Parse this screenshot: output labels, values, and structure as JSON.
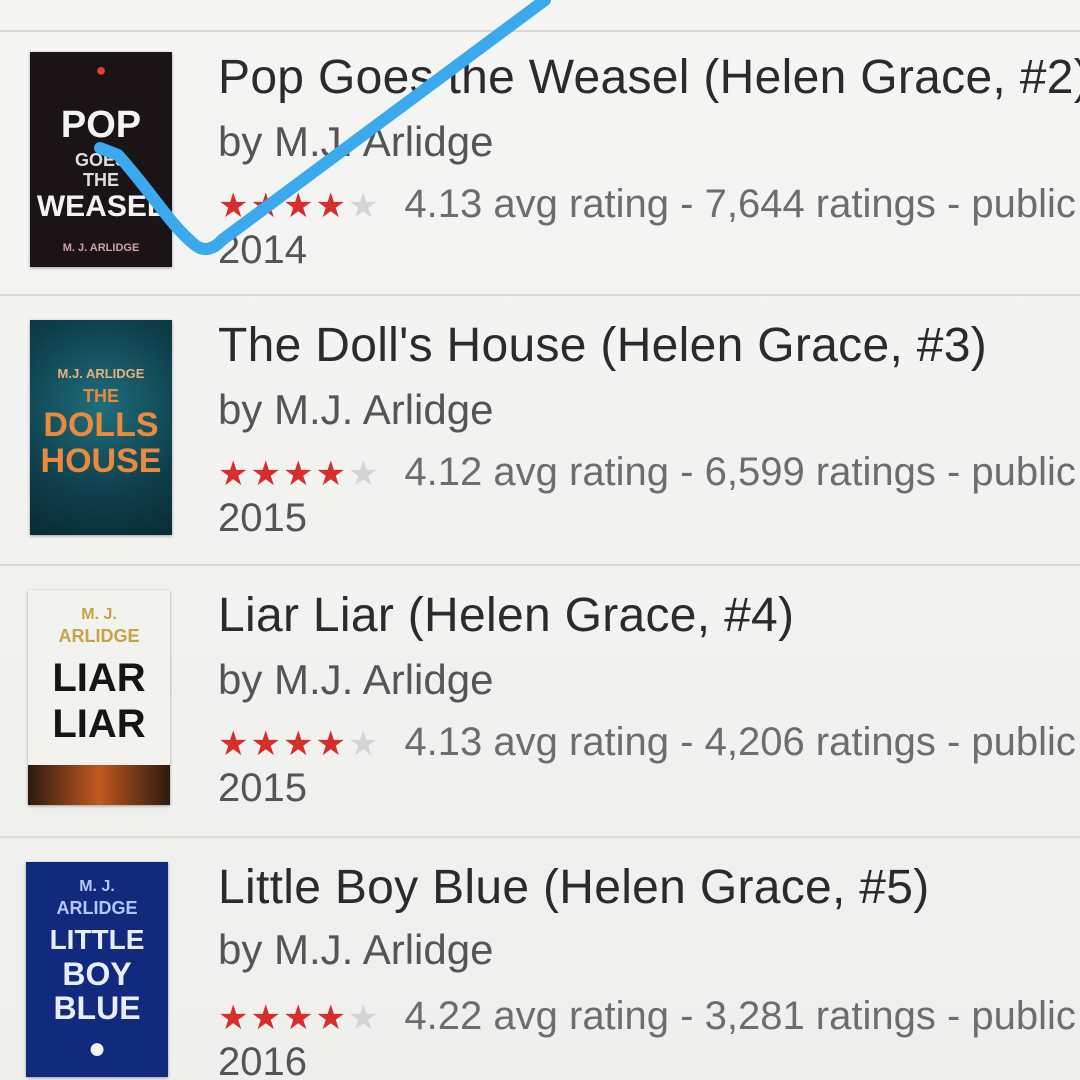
{
  "books": [
    {
      "title": "Pop Goes the Weasel (Helen Grace, #2)",
      "author": "by M.J. Arlidge",
      "rating_stars": 4,
      "meta": "4.13 avg rating - 7,644 ratings - public",
      "year": "2014",
      "cover_lines": [
        "POP",
        "GOES",
        "THE",
        "WEASEL",
        "M. J. ARLIDGE"
      ]
    },
    {
      "title": "The Doll's House (Helen Grace, #3)",
      "author": "by M.J. Arlidge",
      "rating_stars": 4,
      "meta": "4.12 avg rating - 6,599 ratings - public",
      "year": "2015",
      "cover_lines": [
        "M.J. ARLIDGE",
        "THE",
        "DOLLS",
        "HOUSE"
      ]
    },
    {
      "title": "Liar Liar (Helen Grace, #4)",
      "author": "by M.J. Arlidge",
      "rating_stars": 4,
      "meta": "4.13 avg rating - 4,206 ratings - public",
      "year": "2015",
      "cover_lines": [
        "M. J.",
        "ARLIDGE",
        "LIAR",
        "LIAR"
      ]
    },
    {
      "title": "Little Boy Blue (Helen Grace, #5)",
      "author": "by M.J. Arlidge",
      "rating_stars": 4,
      "meta": "4.22 avg rating - 3,281 ratings - public",
      "year": "2016",
      "cover_lines": [
        "M. J.",
        "ARLIDGE",
        "LITTLE",
        "BOY",
        "BLUE"
      ]
    }
  ],
  "colors": {
    "star_full": "#d62d2d",
    "star_empty": "#d4d4d4",
    "checkmark": "#3aa9ee"
  }
}
